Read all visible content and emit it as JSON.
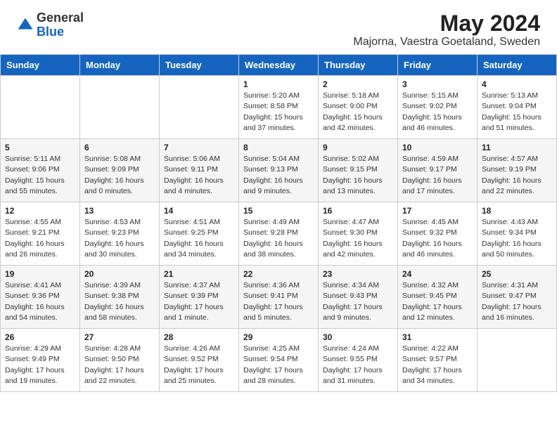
{
  "header": {
    "logo_general": "General",
    "logo_blue": "Blue",
    "month_year": "May 2024",
    "location": "Majorna, Vaestra Goetaland, Sweden"
  },
  "weekdays": [
    "Sunday",
    "Monday",
    "Tuesday",
    "Wednesday",
    "Thursday",
    "Friday",
    "Saturday"
  ],
  "weeks": [
    [
      {
        "day": "",
        "detail": ""
      },
      {
        "day": "",
        "detail": ""
      },
      {
        "day": "",
        "detail": ""
      },
      {
        "day": "1",
        "detail": "Sunrise: 5:20 AM\nSunset: 8:58 PM\nDaylight: 15 hours and 37 minutes."
      },
      {
        "day": "2",
        "detail": "Sunrise: 5:18 AM\nSunset: 9:00 PM\nDaylight: 15 hours and 42 minutes."
      },
      {
        "day": "3",
        "detail": "Sunrise: 5:15 AM\nSunset: 9:02 PM\nDaylight: 15 hours and 46 minutes."
      },
      {
        "day": "4",
        "detail": "Sunrise: 5:13 AM\nSunset: 9:04 PM\nDaylight: 15 hours and 51 minutes."
      }
    ],
    [
      {
        "day": "5",
        "detail": "Sunrise: 5:11 AM\nSunset: 9:06 PM\nDaylight: 15 hours and 55 minutes."
      },
      {
        "day": "6",
        "detail": "Sunrise: 5:08 AM\nSunset: 9:09 PM\nDaylight: 16 hours and 0 minutes."
      },
      {
        "day": "7",
        "detail": "Sunrise: 5:06 AM\nSunset: 9:11 PM\nDaylight: 16 hours and 4 minutes."
      },
      {
        "day": "8",
        "detail": "Sunrise: 5:04 AM\nSunset: 9:13 PM\nDaylight: 16 hours and 9 minutes."
      },
      {
        "day": "9",
        "detail": "Sunrise: 5:02 AM\nSunset: 9:15 PM\nDaylight: 16 hours and 13 minutes."
      },
      {
        "day": "10",
        "detail": "Sunrise: 4:59 AM\nSunset: 9:17 PM\nDaylight: 16 hours and 17 minutes."
      },
      {
        "day": "11",
        "detail": "Sunrise: 4:57 AM\nSunset: 9:19 PM\nDaylight: 16 hours and 22 minutes."
      }
    ],
    [
      {
        "day": "12",
        "detail": "Sunrise: 4:55 AM\nSunset: 9:21 PM\nDaylight: 16 hours and 26 minutes."
      },
      {
        "day": "13",
        "detail": "Sunrise: 4:53 AM\nSunset: 9:23 PM\nDaylight: 16 hours and 30 minutes."
      },
      {
        "day": "14",
        "detail": "Sunrise: 4:51 AM\nSunset: 9:25 PM\nDaylight: 16 hours and 34 minutes."
      },
      {
        "day": "15",
        "detail": "Sunrise: 4:49 AM\nSunset: 9:28 PM\nDaylight: 16 hours and 38 minutes."
      },
      {
        "day": "16",
        "detail": "Sunrise: 4:47 AM\nSunset: 9:30 PM\nDaylight: 16 hours and 42 minutes."
      },
      {
        "day": "17",
        "detail": "Sunrise: 4:45 AM\nSunset: 9:32 PM\nDaylight: 16 hours and 46 minutes."
      },
      {
        "day": "18",
        "detail": "Sunrise: 4:43 AM\nSunset: 9:34 PM\nDaylight: 16 hours and 50 minutes."
      }
    ],
    [
      {
        "day": "19",
        "detail": "Sunrise: 4:41 AM\nSunset: 9:36 PM\nDaylight: 16 hours and 54 minutes."
      },
      {
        "day": "20",
        "detail": "Sunrise: 4:39 AM\nSunset: 9:38 PM\nDaylight: 16 hours and 58 minutes."
      },
      {
        "day": "21",
        "detail": "Sunrise: 4:37 AM\nSunset: 9:39 PM\nDaylight: 17 hours and 1 minute."
      },
      {
        "day": "22",
        "detail": "Sunrise: 4:36 AM\nSunset: 9:41 PM\nDaylight: 17 hours and 5 minutes."
      },
      {
        "day": "23",
        "detail": "Sunrise: 4:34 AM\nSunset: 9:43 PM\nDaylight: 17 hours and 9 minutes."
      },
      {
        "day": "24",
        "detail": "Sunrise: 4:32 AM\nSunset: 9:45 PM\nDaylight: 17 hours and 12 minutes."
      },
      {
        "day": "25",
        "detail": "Sunrise: 4:31 AM\nSunset: 9:47 PM\nDaylight: 17 hours and 16 minutes."
      }
    ],
    [
      {
        "day": "26",
        "detail": "Sunrise: 4:29 AM\nSunset: 9:49 PM\nDaylight: 17 hours and 19 minutes."
      },
      {
        "day": "27",
        "detail": "Sunrise: 4:28 AM\nSunset: 9:50 PM\nDaylight: 17 hours and 22 minutes."
      },
      {
        "day": "28",
        "detail": "Sunrise: 4:26 AM\nSunset: 9:52 PM\nDaylight: 17 hours and 25 minutes."
      },
      {
        "day": "29",
        "detail": "Sunrise: 4:25 AM\nSunset: 9:54 PM\nDaylight: 17 hours and 28 minutes."
      },
      {
        "day": "30",
        "detail": "Sunrise: 4:24 AM\nSunset: 9:55 PM\nDaylight: 17 hours and 31 minutes."
      },
      {
        "day": "31",
        "detail": "Sunrise: 4:22 AM\nSunset: 9:57 PM\nDaylight: 17 hours and 34 minutes."
      },
      {
        "day": "",
        "detail": ""
      }
    ]
  ]
}
